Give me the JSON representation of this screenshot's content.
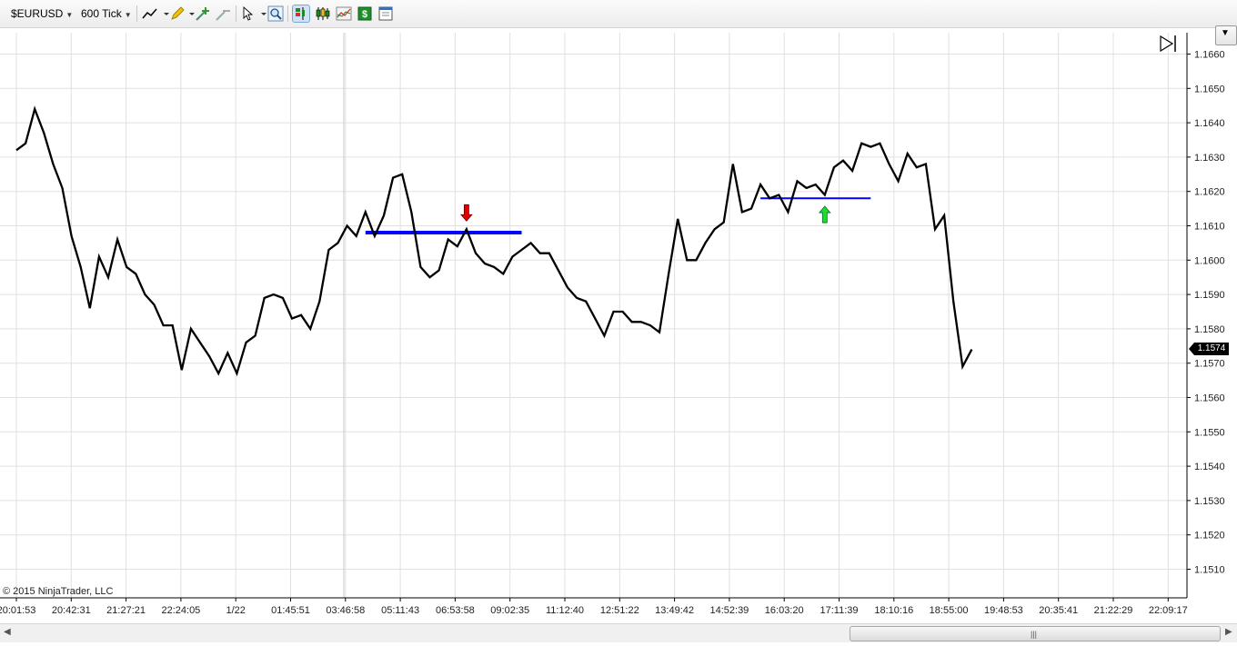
{
  "toolbar": {
    "instrument": "$EURUSD",
    "interval": "600 Tick"
  },
  "icons": {
    "draw_line": "line-draw-icon",
    "pencil": "pencil-icon",
    "add_indicator": "indicator-add-icon",
    "remove_indicator": "indicator-remove-icon",
    "pointer": "pointer-icon",
    "zoom": "zoom-icon",
    "order_panel": "order-panel-icon",
    "bar_type": "candlestick-icon",
    "chart_style": "chart-style-icon",
    "money": "dollar-icon",
    "properties": "properties-icon",
    "scroll_end": "scroll-to-end-icon",
    "menu": "chart-menu-dropdown-icon"
  },
  "copyright": "© 2015 NinjaTrader, LLC",
  "last_price_label": "1.1574",
  "colors": {
    "price_line": "#000000",
    "hline": "#0000ff",
    "arrow_down": "#e00000",
    "arrow_up": "#22dd22",
    "grid": "#e0e0e0"
  },
  "chart_data": {
    "type": "line",
    "title": "",
    "xlabel": "",
    "ylabel": "",
    "ylim": [
      1.1503,
      1.1667
    ],
    "y_ticks": [
      "1.1660",
      "1.1650",
      "1.1640",
      "1.1630",
      "1.1620",
      "1.1610",
      "1.1600",
      "1.1590",
      "1.1580",
      "1.1570",
      "1.1560",
      "1.1550",
      "1.1540",
      "1.1530",
      "1.1520",
      "1.1510"
    ],
    "x_ticks": [
      "20:01:53",
      "20:42:31",
      "21:27:21",
      "22:24:05",
      "1/22",
      "01:45:51",
      "03:46:58",
      "05:11:43",
      "06:53:58",
      "09:02:35",
      "11:12:40",
      "12:51:22",
      "13:49:42",
      "14:52:39",
      "16:03:20",
      "17:11:39",
      "18:10:16",
      "18:55:00",
      "19:48:53",
      "20:35:41",
      "21:22:29",
      "22:09:17"
    ],
    "grid": true,
    "last_price": 1.1574,
    "series": [
      {
        "values": [
          1.1632,
          1.1634,
          1.1644,
          1.1637,
          1.1628,
          1.1621,
          1.1607,
          1.1598,
          1.1586,
          1.1601,
          1.1595,
          1.1606,
          1.1598,
          1.1596,
          1.159,
          1.1587,
          1.1581,
          1.1581,
          1.1568,
          1.158,
          1.1576,
          1.1572,
          1.1567,
          1.1573,
          1.1567,
          1.1576,
          1.1578,
          1.1589,
          1.159,
          1.1589,
          1.1583,
          1.1584,
          1.158,
          1.1588,
          1.1603,
          1.1605,
          1.161,
          1.1607,
          1.1614,
          1.1607,
          1.1613,
          1.1624,
          1.1625,
          1.1614,
          1.1598,
          1.1595,
          1.1597,
          1.1606,
          1.1604,
          1.1609,
          1.1602,
          1.1599,
          1.1598,
          1.1596,
          1.1601,
          1.1603,
          1.1605,
          1.1602,
          1.1602,
          1.1597,
          1.1592,
          1.1589,
          1.1588,
          1.1583,
          1.1578,
          1.1585,
          1.1585,
          1.1582,
          1.1582,
          1.1581,
          1.1579,
          1.1596,
          1.1612,
          1.16,
          1.16,
          1.1605,
          1.1609,
          1.1611,
          1.1628,
          1.1614,
          1.1615,
          1.1622,
          1.1618,
          1.1619,
          1.1614,
          1.1623,
          1.1621,
          1.1622,
          1.1619,
          1.1627,
          1.1629,
          1.1626,
          1.1634,
          1.1633,
          1.1634,
          1.1628,
          1.1623,
          1.1631,
          1.1627,
          1.1628,
          1.1609,
          1.1613,
          1.1588,
          1.1569,
          1.1574
        ]
      }
    ],
    "horizontal_lines": [
      {
        "price": 1.1608,
        "start_bar": 38,
        "end_bar": 55
      },
      {
        "price": 1.1618,
        "start_bar": 81,
        "end_bar": 93
      }
    ],
    "signals": [
      {
        "type": "down",
        "bar": 49,
        "price": 1.1609
      },
      {
        "type": "up",
        "bar": 88,
        "price": 1.1617
      }
    ]
  }
}
